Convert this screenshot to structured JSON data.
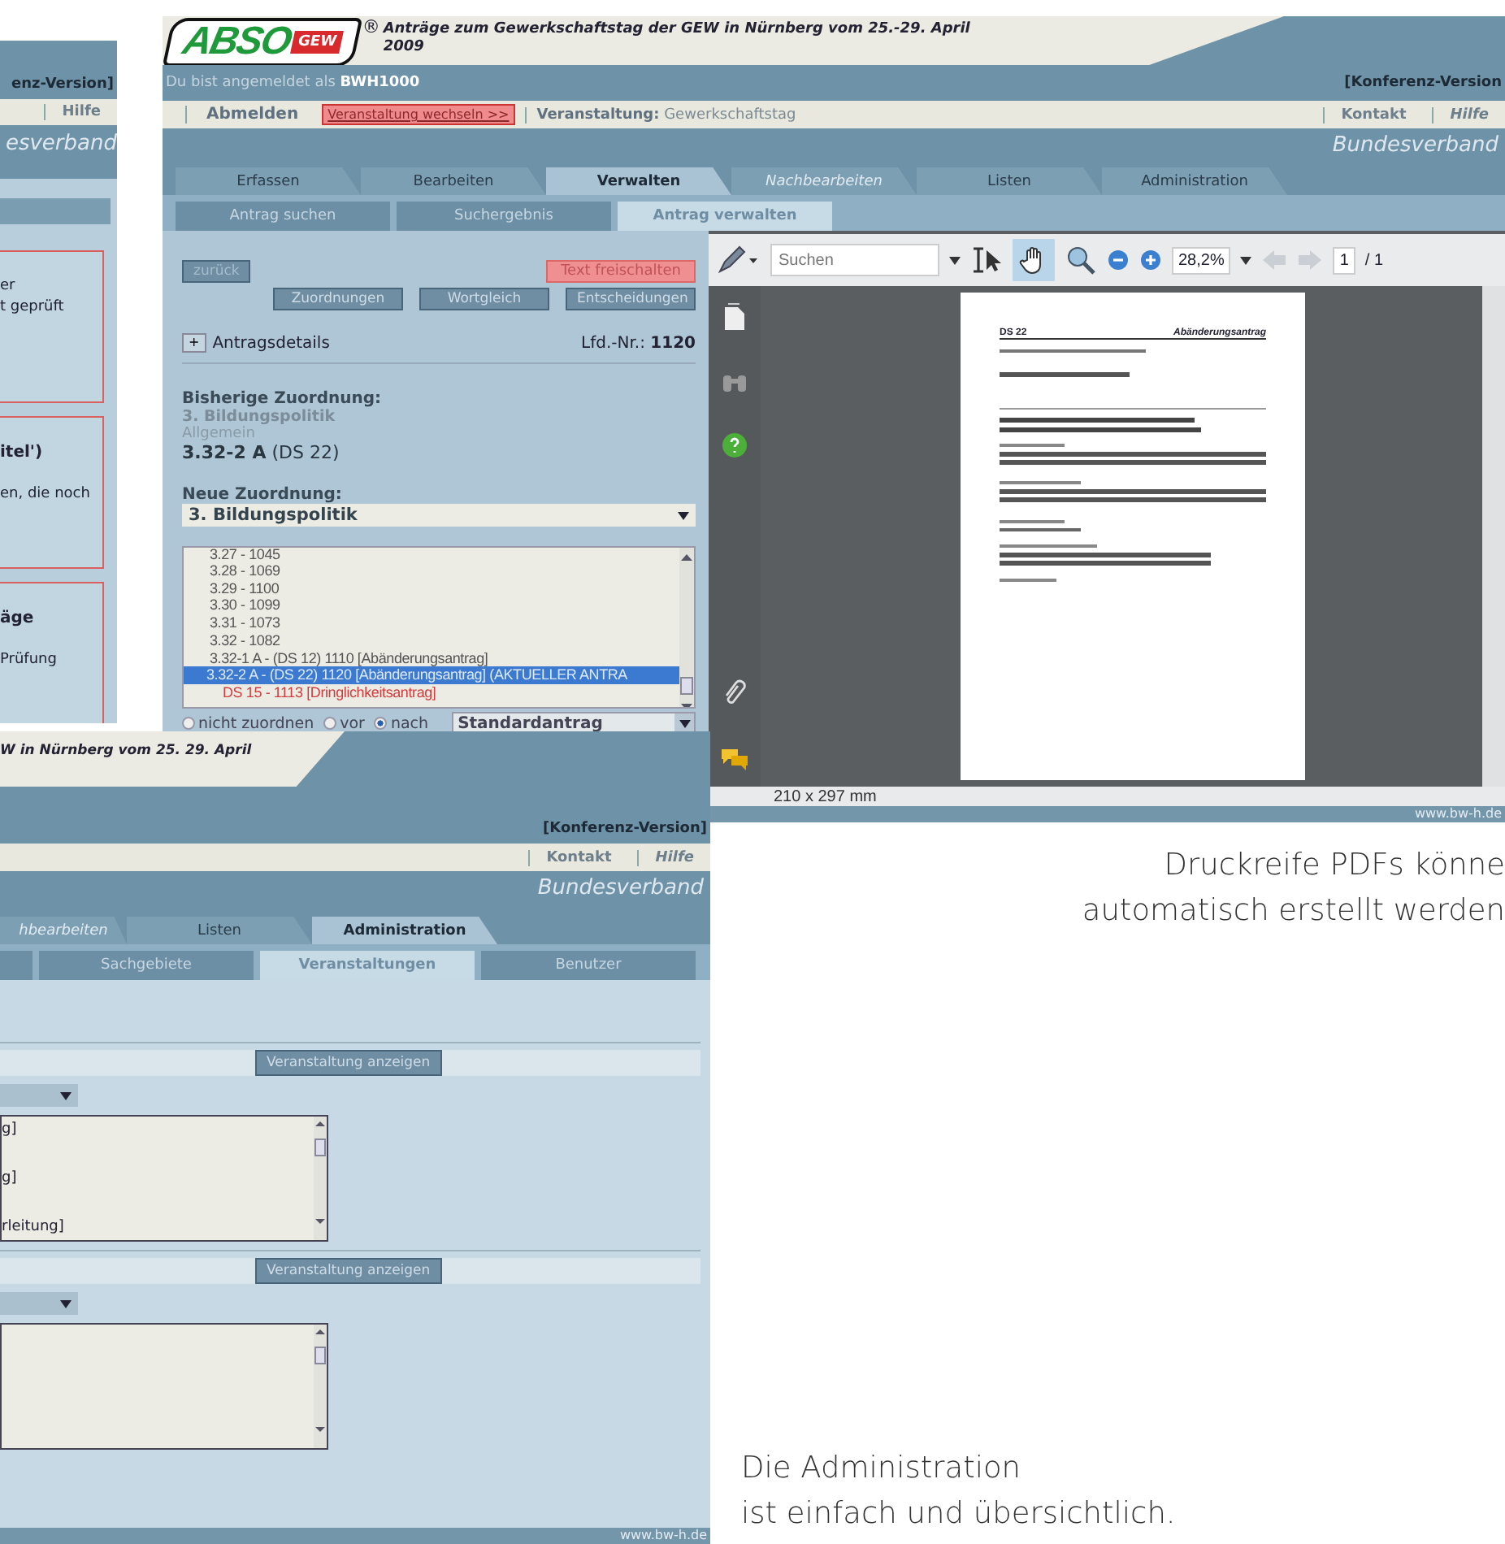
{
  "back_window": {
    "version": "enz-Version]",
    "menu_item": "Hilfe",
    "org": "esverband",
    "boxes": [
      {
        "lines": [
          "er",
          "t geprüft"
        ]
      },
      {
        "title": "itel')",
        "lines": [
          "en, die noch"
        ]
      },
      {
        "title": "äge",
        "lines": [
          "Prüfung"
        ]
      }
    ]
  },
  "main_window": {
    "logo": {
      "text": "ABSO",
      "badge": "GEW",
      "mark": "®"
    },
    "title": [
      "Anträge zum Gewerkschaftstag der GEW in Nürnberg vom 25.-29. April",
      "2009"
    ],
    "login": {
      "label": "Du bist angemeldet als",
      "user": "BWH1000"
    },
    "version": "[Konferenz-Version",
    "nav": [
      {
        "label": "Abmelden",
        "kind": "plain"
      },
      {
        "label": "Veranstaltung wechseln >>",
        "kind": "alert"
      }
    ],
    "event": {
      "label": "Veranstaltung:",
      "value": "Gewerkschaftstag"
    },
    "nav_right": [
      "Kontakt",
      "Hilfe"
    ],
    "org": "Bundesverband",
    "tabs": [
      {
        "label": "Erfassen",
        "selected": false,
        "disabled": false
      },
      {
        "label": "Bearbeiten",
        "selected": false,
        "disabled": false
      },
      {
        "label": "Verwalten",
        "selected": true,
        "disabled": false
      },
      {
        "label": "Nachbearbeiten",
        "selected": false,
        "disabled": true
      },
      {
        "label": "Listen",
        "selected": false,
        "disabled": false
      },
      {
        "label": "Administration",
        "selected": false,
        "disabled": false
      }
    ],
    "subtabs": [
      {
        "label": "Antrag suchen",
        "selected": false
      },
      {
        "label": "Suchergebnis",
        "selected": false
      },
      {
        "label": "Antrag verwalten",
        "selected": true
      }
    ],
    "panel": {
      "back_button": {
        "label": "zurück",
        "disabled": true
      },
      "release_button": "Text freischalten",
      "buttons": [
        "Zuordnungen",
        "Wortgleich",
        "Entscheidungen"
      ],
      "details": {
        "toggle": "+",
        "label": "Antragsdetails",
        "number_label": "Lfd.-Nr.:",
        "number": "1120"
      },
      "previous": {
        "heading": "Bisherige Zuordnung:",
        "area": "3. Bildungspolitik",
        "sub": "Allgemein",
        "code": "3.32-2 A",
        "ref": "(DS 22)"
      },
      "new": {
        "heading": "Neue Zuordnung:",
        "value": "3. Bildungspolitik"
      },
      "list": [
        {
          "text": "3.27 - 1045",
          "selected": false,
          "urgent": false
        },
        {
          "text": "3.28 - 1069",
          "selected": false,
          "urgent": false
        },
        {
          "text": "3.29 - 1100",
          "selected": false,
          "urgent": false
        },
        {
          "text": "3.30 - 1099",
          "selected": false,
          "urgent": false
        },
        {
          "text": "3.31 - 1073",
          "selected": false,
          "urgent": false
        },
        {
          "text": "3.32 - 1082",
          "selected": false,
          "urgent": false
        },
        {
          "text": "3.32-1 A - (DS 12) 1110 [Abänderungsantrag]",
          "selected": false,
          "urgent": false
        },
        {
          "text": "3.32-2 A - (DS 22) 1120 [Abänderungsantrag] (AKTUELLER ANTRA",
          "selected": true,
          "urgent": false
        },
        {
          "text": "DS 15 - 1113 [Dringlichkeitsantrag]",
          "selected": false,
          "urgent": true
        }
      ],
      "radios": [
        {
          "label": "nicht zuordnen",
          "selected": false
        },
        {
          "label": "vor",
          "selected": false
        },
        {
          "label": "nach",
          "selected": true
        }
      ],
      "type_select": "Standardantrag"
    },
    "pdf": {
      "search_placeholder": "Suchen",
      "zoom": "28,2%",
      "page": "1",
      "page_total": "/ 1",
      "doc_number": "DS 22",
      "doc_type": "Abänderungsantrag",
      "page_size": "210 x 297 mm"
    },
    "footer": "www.bw-h.de"
  },
  "lower_window": {
    "title": "W in Nürnberg vom 25. 29. April",
    "version": "[Konferenz-Version]",
    "nav_right": [
      "Kontakt",
      "Hilfe"
    ],
    "org": "Bundesverband",
    "tabs": [
      {
        "label": "hbearbeiten",
        "selected": false,
        "disabled": true
      },
      {
        "label": "Listen",
        "selected": false,
        "disabled": false
      },
      {
        "label": "Administration",
        "selected": true,
        "disabled": false
      }
    ],
    "subtabs": [
      {
        "label": "Sachgebiete",
        "selected": false
      },
      {
        "label": "Veranstaltungen",
        "selected": true
      },
      {
        "label": "Benutzer",
        "selected": false
      }
    ],
    "sections": [
      {
        "button": "Veranstaltung anzeigen",
        "list": [
          "g]",
          "g]",
          "rleitung]"
        ]
      },
      {
        "button": "Veranstaltung anzeigen"
      }
    ],
    "footer": "www.bw-h.de"
  },
  "captions": [
    {
      "lines": [
        "Druckreife PDFs könne",
        "automatisch erstellt werden"
      ]
    },
    {
      "lines": [
        "Die Administration",
        "ist einfach und übersichtlich."
      ]
    }
  ]
}
